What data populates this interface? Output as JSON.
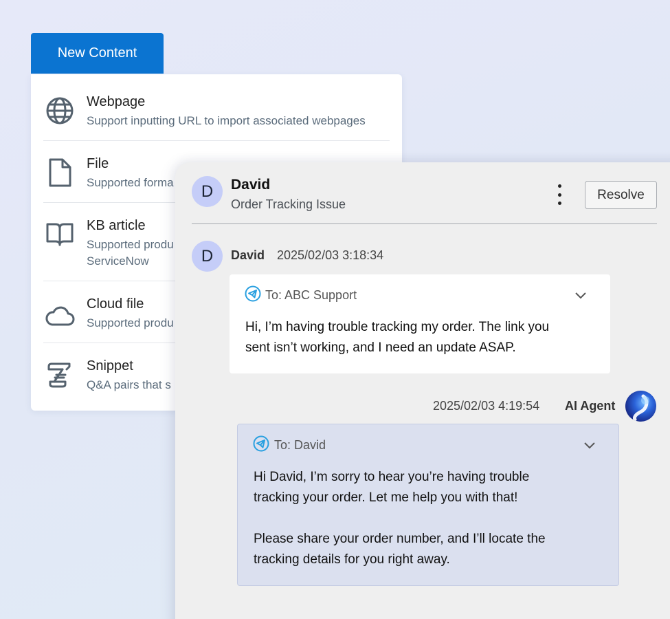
{
  "new_content": {
    "button_label": "New Content",
    "items": [
      {
        "icon": "globe-icon",
        "title": "Webpage",
        "desc": [
          "Support inputting URL to import associated webpages"
        ]
      },
      {
        "icon": "file-icon",
        "title": "File",
        "desc": [
          "Supported forma"
        ]
      },
      {
        "icon": "book-icon",
        "title": "KB article",
        "desc": [
          "Supported produ",
          "ServiceNow"
        ]
      },
      {
        "icon": "cloud-icon",
        "title": "Cloud file",
        "desc": [
          "Supported produ"
        ]
      },
      {
        "icon": "scroll-icon",
        "title": "Snippet",
        "desc": [
          "Q&A pairs that s"
        ]
      }
    ]
  },
  "chat": {
    "header": {
      "avatar_initial": "D",
      "name": "David",
      "subject": "Order Tracking Issue",
      "resolve_label": "Resolve"
    },
    "messages": [
      {
        "avatar_initial": "D",
        "sender": "David",
        "timestamp": "2025/02/03 3:18:34",
        "to": "To: ABC Support",
        "body": [
          "Hi, I’m having trouble tracking my order. The link you",
          "sent isn’t working, and I need an update ASAP."
        ]
      },
      {
        "sender": "AI Agent",
        "timestamp": "2025/02/03 4:19:54",
        "to": "To: David",
        "body": [
          "Hi David, I’m sorry to hear you’re having trouble",
          "tracking your order. Let me help you with that!",
          "",
          "Please share your order number, and I’ll locate the",
          "tracking details for you right away."
        ]
      }
    ]
  },
  "colors": {
    "primary": "#0b74d1",
    "avatar_bg": "#c5cdf8",
    "ai_card_bg": "#dbe0ef",
    "send_icon": "#2aa0e0"
  }
}
